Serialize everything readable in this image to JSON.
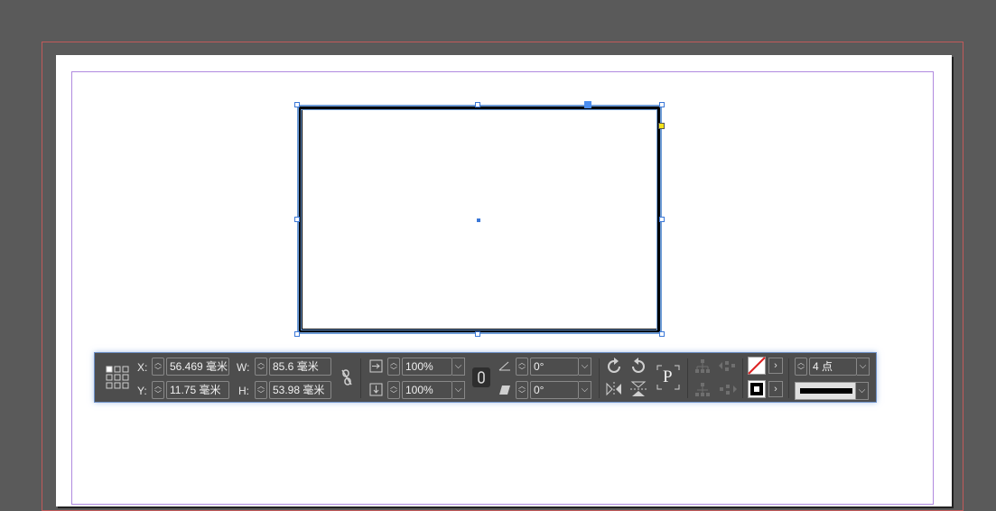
{
  "control_panel": {
    "x_label": "X:",
    "x_value": "56.469 毫米",
    "y_label": "Y:",
    "y_value": "11.75 毫米",
    "w_label": "W:",
    "w_value": "85.6 毫米",
    "h_label": "H:",
    "h_value": "53.98 毫米",
    "scale_x_value": "100%",
    "scale_y_value": "100%",
    "rotation_value": "0°",
    "shear_value": "0°",
    "paragraph_style_letter": "P",
    "stroke_weight_value": "4 点"
  },
  "colors": {
    "canvas_bg": "#5a5a5a",
    "bleed_guide": "#c25a5a",
    "margin_guide": "#b08adf",
    "selection": "#3b78d8",
    "toolbar_bg": "#4d4d4d"
  },
  "icons": [
    "reference-point-icon",
    "constrain-proportions-icon",
    "link-icon",
    "rotate-cw-icon",
    "rotate-ccw-icon",
    "flip-horizontal-icon",
    "flip-vertical-icon",
    "select-container-icon",
    "select-content-icon",
    "fill-none-icon",
    "stroke-black-icon"
  ]
}
